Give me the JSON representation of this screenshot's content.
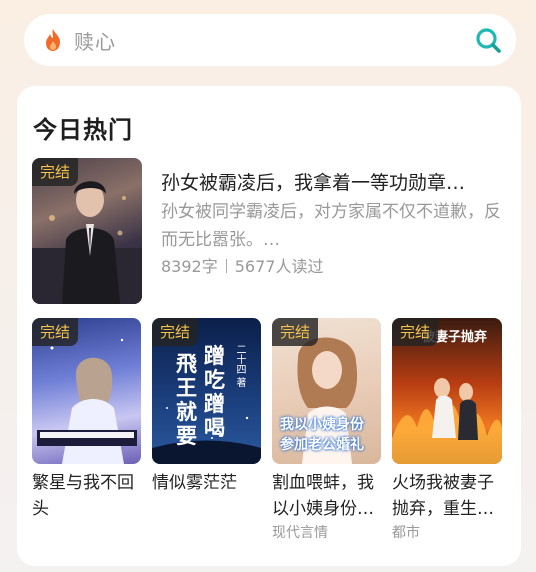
{
  "search": {
    "placeholder": "赎心",
    "icon": "flame-icon",
    "button_icon": "search-icon"
  },
  "section": {
    "title": "今日热门"
  },
  "badge_label": "完结",
  "featured": {
    "title": "孙女被霸凌后，我拿着一等功勋章…",
    "description": "孙女被同学霸凌后，对方家属不仅不道歉，反而无比嚣张。…",
    "word_count": "8392字",
    "readers": "5677人读过"
  },
  "books": [
    {
      "title": "繁星与我不回头",
      "category": ""
    },
    {
      "title": "情似雾茫茫",
      "category": "",
      "cover_text": [
        "飛",
        "王",
        "就",
        "要",
        "蹭",
        "吃",
        "蹭",
        "喝",
        "二十四 著"
      ]
    },
    {
      "title": "割血喂蚌，我以小姨身份…",
      "category": "现代言情",
      "cover_text": [
        "我以小姨身份",
        "参加老公婚礼"
      ]
    },
    {
      "title": "火场我被妻子抛弃，重生…",
      "category": "都市",
      "cover_text": [
        "被妻子抛弃"
      ]
    }
  ],
  "colors": {
    "accent_teal": "#1fb8b2",
    "badge_text": "#f3c24c",
    "flame": "#f06a2b"
  }
}
